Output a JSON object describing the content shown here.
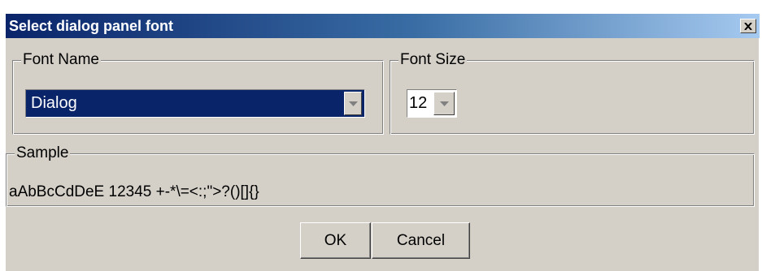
{
  "window": {
    "title": "Select dialog panel font",
    "close_icon": "close-x-icon",
    "titlebar_colors": [
      "#0a246a",
      "#a6caf0"
    ]
  },
  "font_name": {
    "legend": "Font Name",
    "selected_value": "Dialog",
    "dropdown_icon": "chevron-down-icon"
  },
  "font_size": {
    "legend": "Font Size",
    "selected_value": "12",
    "dropdown_icon": "chevron-down-icon"
  },
  "sample": {
    "legend": "Sample",
    "text": "aAbBcCdDeE 12345 +-*\\=<:;\">?()[]{}"
  },
  "buttons": {
    "ok_label": "OK",
    "cancel_label": "Cancel"
  },
  "colors": {
    "dialog_bg": "#d4d0c8",
    "selection_bg": "#0a246a"
  }
}
